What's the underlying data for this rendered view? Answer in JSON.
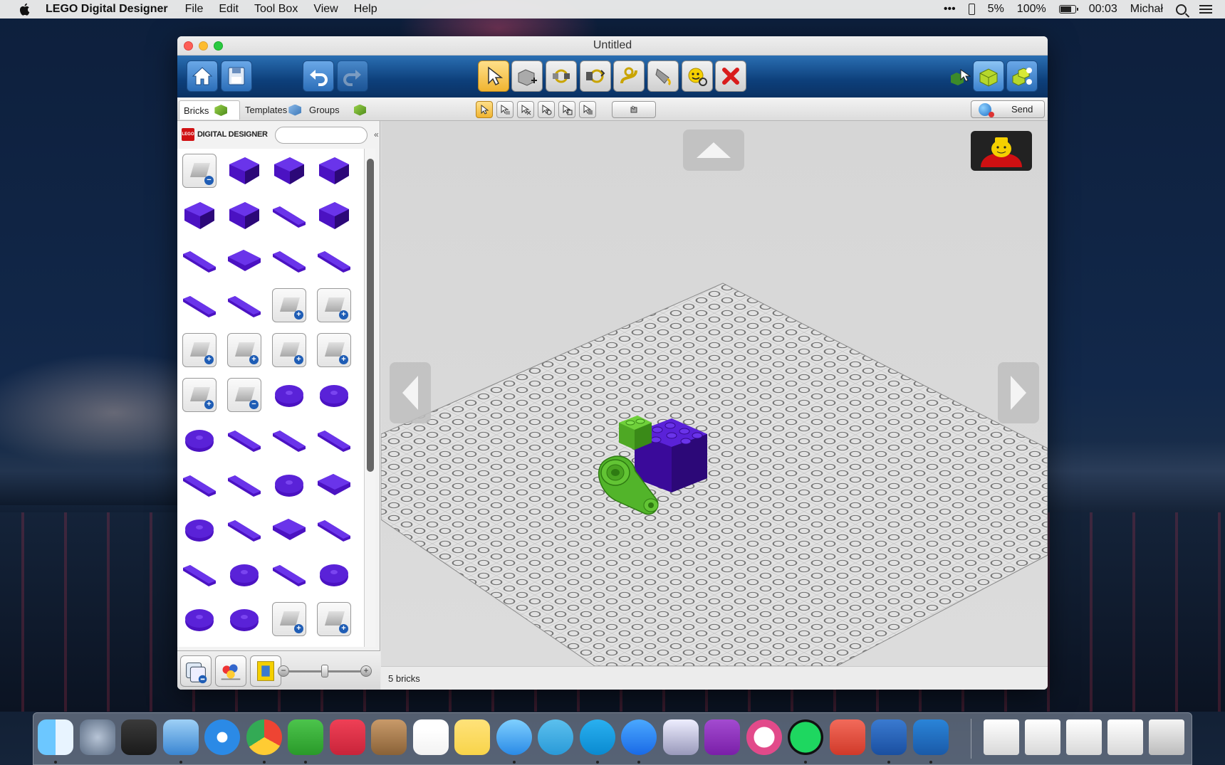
{
  "menubar": {
    "app_name": "LEGO Digital Designer",
    "menus": [
      "File",
      "Edit",
      "Tool Box",
      "View",
      "Help"
    ],
    "status": {
      "more": "•••",
      "cpu": "5%",
      "battery": "100%",
      "time": "00:03",
      "user": "Michał"
    }
  },
  "window": {
    "title": "Untitled"
  },
  "subbar": {
    "tabs": [
      "Bricks",
      "Templates",
      "Groups"
    ],
    "send_label": "Send"
  },
  "leftpanel": {
    "logo_text": "LEGO",
    "title": "DIGITAL DESIGNER",
    "search_value": "",
    "collapse_glyph": "«",
    "zoom_level": 0.5
  },
  "canvas": {
    "status_text": "5 bricks"
  },
  "colors": {
    "purple_brick": "#4b12c2",
    "green_brick": "#5cb82e",
    "toolbar_blue": "#0d3f7a",
    "active_tool": "#f0b431"
  },
  "icons": {
    "toolbar": [
      "home-icon",
      "save-icon",
      "undo-icon",
      "redo-icon",
      "select-icon",
      "clone-icon",
      "hinge-icon",
      "hinge-align-icon",
      "flex-icon",
      "paint-icon",
      "decoration-icon",
      "delete-icon",
      "build-mode-icon",
      "view-mode-icon",
      "instructions-mode-icon"
    ],
    "select_tools": [
      "single-select-icon",
      "connected-select-icon",
      "same-color-select-icon",
      "same-brick-select-icon",
      "invert-select-icon",
      "select-all-icon"
    ]
  }
}
